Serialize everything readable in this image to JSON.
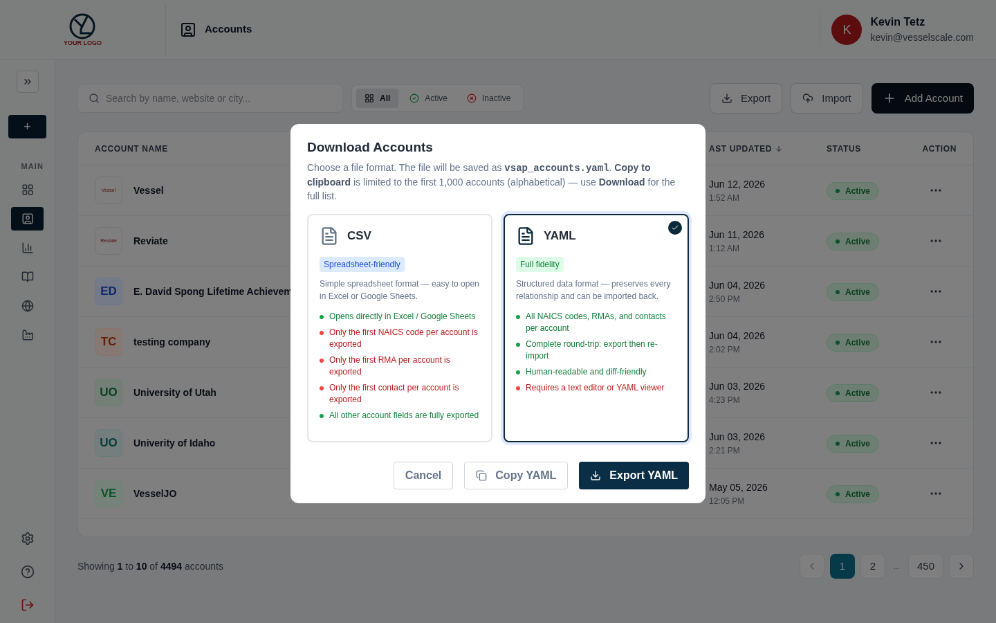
{
  "header": {
    "logo_text": "YOUR LOGO",
    "page_title": "Accounts",
    "user": {
      "initial": "K",
      "name": "Kevin Tetz",
      "email": "kevin@vesselscale.com"
    }
  },
  "sidebar": {
    "add_label": "+",
    "section": "MAIN",
    "items": [
      {
        "selected": false
      },
      {
        "selected": true
      },
      {
        "selected": false
      },
      {
        "selected": false
      },
      {
        "selected": false
      },
      {
        "selected": false
      }
    ]
  },
  "toolbar": {
    "search": {
      "placeholder": "Search by name, website or city..."
    },
    "filters": [
      {
        "label": "All",
        "selected": true
      },
      {
        "label": "Active",
        "selected": false
      },
      {
        "label": "Inactive",
        "selected": false
      }
    ],
    "buttons": [
      {
        "label": "Export",
        "kind": "export"
      },
      {
        "label": "Import",
        "kind": "import"
      },
      {
        "label": "Add Account",
        "kind": "primary"
      }
    ]
  },
  "table": {
    "columns": [
      {
        "label": "ACCOUNT NAME"
      },
      {
        "label": "AST UPDATED",
        "sorted": true
      },
      {
        "label": "STATUS"
      },
      {
        "label": "ACTION"
      }
    ],
    "rows": [
      {
        "kind": "logo",
        "logo_text": "Vessel",
        "name": "Vessel",
        "date": "Jun 12, 2026",
        "time": "1:52 AM",
        "status": "Active"
      },
      {
        "kind": "logo",
        "logo_text": "Reviate",
        "name": "Reviate",
        "date": "Jun 11, 2026",
        "time": "1:12 AM",
        "status": "Active"
      },
      {
        "kind": "initials",
        "initials": "ED",
        "color": "#0e276c",
        "name": "E. David Spong Lifetime Achievem",
        "date": "Jun 04, 2026",
        "time": "2:50 PM",
        "status": "Active"
      },
      {
        "kind": "initials",
        "initials": "TC",
        "color": "#612006",
        "name": "testing company",
        "date": "Jun 04, 2026",
        "time": "2:02 PM",
        "status": "Active"
      },
      {
        "kind": "initials",
        "initials": "UO",
        "color": "#0a401e",
        "name": "University of Utah",
        "date": "Jun 03, 2026",
        "time": "4:23 PM",
        "status": "Active"
      },
      {
        "kind": "initials",
        "initials": "UO",
        "color": "#073b37",
        "name": "Univerity of Idaho",
        "date": "Jun 03, 2026",
        "time": "2:21 PM",
        "status": "Active"
      },
      {
        "kind": "initials",
        "initials": "VE",
        "color": "#0b5125",
        "name": "VesselJO",
        "date": "May 05, 2026",
        "time": "12:05 PM",
        "status": "Active"
      }
    ]
  },
  "footer": {
    "summary": "Showing **1** to **10** of **4494** accounts",
    "pages": [
      {
        "label": "1",
        "selected": true
      },
      {
        "label": "2",
        "selected": false
      },
      {
        "label": "...",
        "kind": "gap"
      },
      {
        "label": "450",
        "selected": false
      }
    ]
  },
  "modal": {
    "title": "Download Accounts",
    "description": {
      "prefix": "Choose a file format. The file will be saved as",
      "filename": "vsap_accounts.yaml",
      "suffix": ". **Copy to clipboard** is limited to the first 1,000 accounts (alphabetical) — use **Download** for the full list."
    },
    "options": [
      {
        "label": "CSV",
        "badge": "Spreadsheet-friendly",
        "selected": false,
        "description": "Simple spreadsheet format — easy to open in Excel or Google Sheets.",
        "features": [
          {
            "text": "Opens directly in Excel / Google Sheets",
            "positive": true
          },
          {
            "text": "Only the first NAICS code per account is exported",
            "positive": false
          },
          {
            "text": "Only the first RMA per account is exported",
            "positive": false
          },
          {
            "text": "Only the first contact per account is exported",
            "positive": false
          },
          {
            "text": "All other account fields are fully exported",
            "positive": true
          }
        ]
      },
      {
        "label": "YAML",
        "badge": "Full fidelity",
        "selected": true,
        "description": "Structured data format — preserves every relationship and can be imported back.",
        "features": [
          {
            "text": "All NAICS codes, RMAs, and contacts per account",
            "positive": true
          },
          {
            "text": "Complete round-trip: export then re-import",
            "positive": true
          },
          {
            "text": "Human-readable and diff-friendly",
            "positive": true
          },
          {
            "text": "Requires a text editor or YAML viewer",
            "positive": false
          }
        ]
      }
    ],
    "buttons": [
      {
        "label": "Cancel",
        "kind": "cancel"
      },
      {
        "label": "Copy YAML",
        "kind": "copy"
      },
      {
        "label": "Export YAML",
        "kind": "primary"
      }
    ]
  }
}
